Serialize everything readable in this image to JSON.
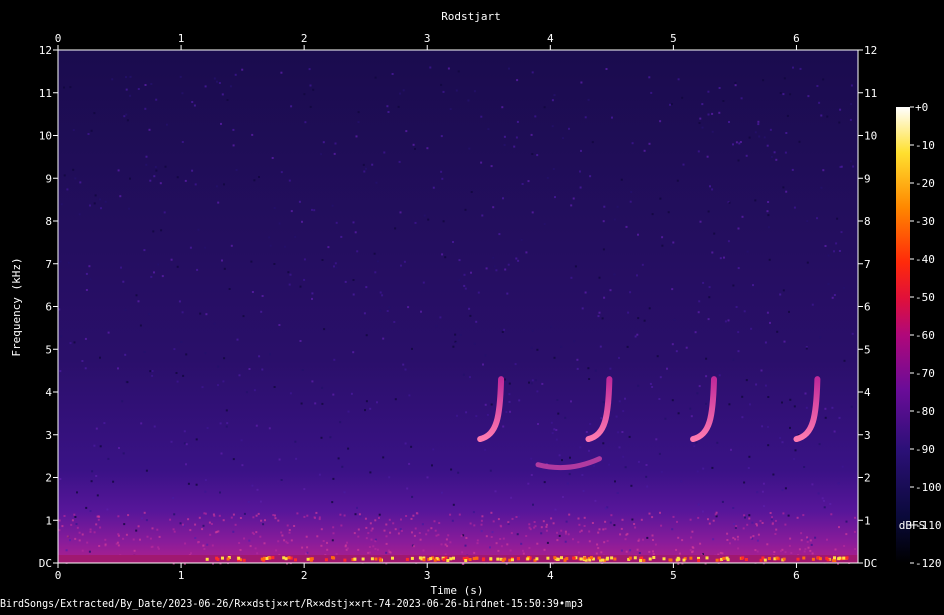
{
  "chart_data": {
    "type": "heatmap",
    "title": "Rodstjart",
    "xlabel": "Time (s)",
    "ylabel": "Frequency (kHz)",
    "footer": "BirdSongs/Extracted/By_Date/2023-06-26/R××dstj××rt/R××dstj××rt-74-2023-06-26-birdnet-15:50:39•mp3",
    "x_range": [
      0,
      6.5
    ],
    "y_range": [
      0,
      12
    ],
    "x_ticks": [
      0,
      1,
      2,
      3,
      4,
      5,
      6
    ],
    "y_ticks": [
      0,
      1,
      2,
      3,
      4,
      5,
      6,
      7,
      8,
      9,
      10,
      11,
      12
    ],
    "y_tick_labels": [
      "DC",
      "1",
      "2",
      "3",
      "4",
      "5",
      "6",
      "7",
      "8",
      "9",
      "10",
      "11",
      "12"
    ],
    "colorbar": {
      "label": "dBFS",
      "ticks": [
        0,
        -10,
        -20,
        -30,
        -40,
        -50,
        -60,
        -70,
        -80,
        -90,
        -100,
        -110,
        -120
      ],
      "tick_labels": [
        "+0",
        "-10",
        "-20",
        "-30",
        "-40",
        "-50",
        "-60",
        "-70",
        "-80",
        "-90",
        "-100",
        "-110",
        "-120"
      ],
      "range": [
        -120,
        0
      ]
    },
    "calls": [
      {
        "start_s": 3.43,
        "end_s": 3.6,
        "freq_high_khz": 4.3,
        "freq_low_khz": 2.9
      },
      {
        "start_s": 4.31,
        "end_s": 4.48,
        "freq_high_khz": 4.3,
        "freq_low_khz": 2.9
      },
      {
        "start_s": 5.16,
        "end_s": 5.33,
        "freq_high_khz": 4.3,
        "freq_low_khz": 2.9
      },
      {
        "start_s": 6.0,
        "end_s": 6.17,
        "freq_high_khz": 4.3,
        "freq_low_khz": 2.9
      }
    ],
    "low_trill": {
      "start_s": 3.9,
      "end_s": 4.4,
      "freq_khz": 2.3
    }
  }
}
